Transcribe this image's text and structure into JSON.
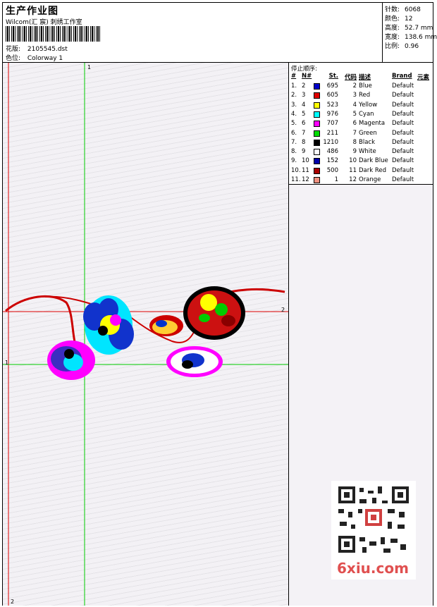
{
  "header": {
    "title": "生产作业图",
    "company": "Wilcom(汇 宸) 刺绣工作室",
    "design_label": "花版:",
    "design_value": "2105545.dst",
    "colorway_label": "色位:",
    "colorway_value": "Colorway 1"
  },
  "stats": [
    {
      "label": "针数:",
      "value": "6068"
    },
    {
      "label": "颜色:",
      "value": "12"
    },
    {
      "label": "高度:",
      "value": "52.7 mm"
    },
    {
      "label": "宽度:",
      "value": "138.6 mm"
    },
    {
      "label": "比例:",
      "value": "0.96"
    }
  ],
  "stops": {
    "title": "停止顺序:",
    "columns": {
      "idx": "#",
      "needle": "N#",
      "st": "St.",
      "code": "代码",
      "desc": "描述",
      "brand": "Brand",
      "elem": "元素"
    },
    "rows": [
      {
        "idx": "1.",
        "needle": "2",
        "color": "#0000cc",
        "st": "695",
        "code": "2",
        "desc": "Blue",
        "brand": "Default"
      },
      {
        "idx": "2.",
        "needle": "3",
        "color": "#e00000",
        "st": "605",
        "code": "3",
        "desc": "Red",
        "brand": "Default"
      },
      {
        "idx": "3.",
        "needle": "4",
        "color": "#ffff00",
        "st": "523",
        "code": "4",
        "desc": "Yellow",
        "brand": "Default"
      },
      {
        "idx": "4.",
        "needle": "5",
        "color": "#00ffff",
        "st": "976",
        "code": "5",
        "desc": "Cyan",
        "brand": "Default"
      },
      {
        "idx": "5.",
        "needle": "6",
        "color": "#ff00ff",
        "st": "707",
        "code": "6",
        "desc": "Magenta",
        "brand": "Default"
      },
      {
        "idx": "6.",
        "needle": "7",
        "color": "#00dd00",
        "st": "211",
        "code": "7",
        "desc": "Green",
        "brand": "Default"
      },
      {
        "idx": "7.",
        "needle": "8",
        "color": "#000000",
        "st": "1210",
        "code": "8",
        "desc": "Black",
        "brand": "Default"
      },
      {
        "idx": "8.",
        "needle": "9",
        "color": "#ffffff",
        "st": "486",
        "code": "9",
        "desc": "White",
        "brand": "Default"
      },
      {
        "idx": "9.",
        "needle": "10",
        "color": "#0000aa",
        "st": "152",
        "code": "10",
        "desc": "Dark Blue",
        "brand": "Default"
      },
      {
        "idx": "10.",
        "needle": "11",
        "color": "#aa0000",
        "st": "500",
        "code": "11",
        "desc": "Dark Red",
        "brand": "Default"
      },
      {
        "idx": "11.",
        "needle": "12",
        "color": "#f09080",
        "st": "1",
        "code": "12",
        "desc": "Orange",
        "brand": "Default"
      }
    ]
  },
  "guides": {
    "v1": "1",
    "h2": "2",
    "h1": "1",
    "v2": "2"
  },
  "watermark": "6xiu.com"
}
